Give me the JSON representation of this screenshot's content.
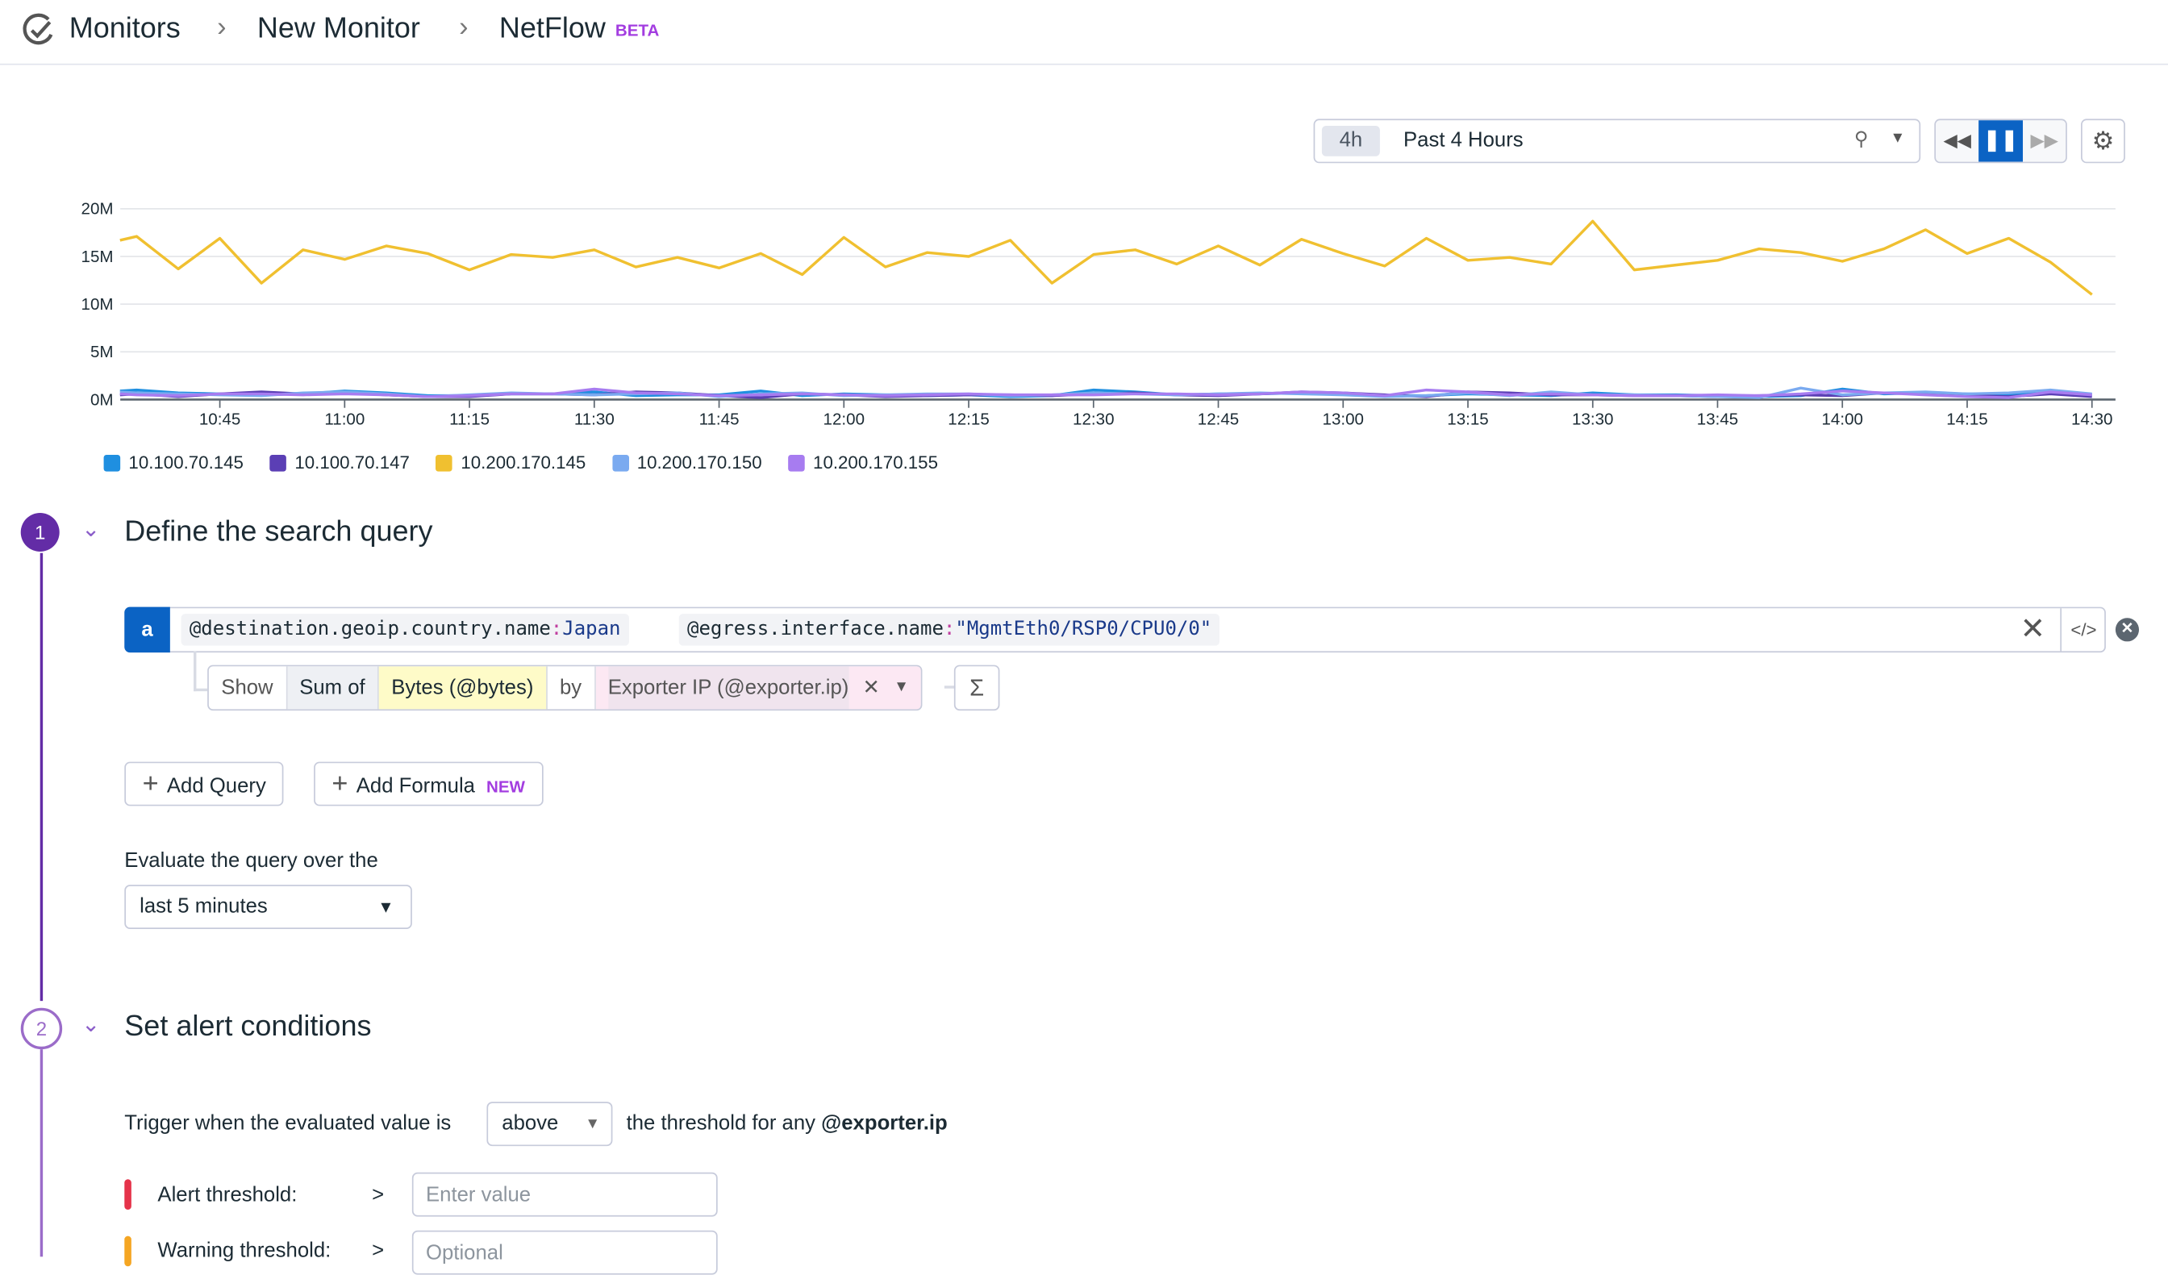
{
  "header": {
    "breadcrumbs": [
      "Monitors",
      "New Monitor",
      "NetFlow"
    ],
    "badge": "BETA"
  },
  "timepicker": {
    "short": "4h",
    "label": "Past 4 Hours"
  },
  "colors": {
    "accent": "#632ca6",
    "primary": "#0b63c4"
  },
  "chart_data": {
    "type": "line",
    "y_ticks": [
      "0M",
      "5M",
      "10M",
      "15M",
      "20M"
    ],
    "ylim": [
      0,
      20
    ],
    "y_unit": "M bytes",
    "x_ticks": [
      "10:45",
      "11:00",
      "11:15",
      "11:30",
      "11:45",
      "12:00",
      "12:15",
      "12:30",
      "12:45",
      "13:00",
      "13:15",
      "13:30",
      "13:45",
      "14:00",
      "14:15",
      "14:30"
    ],
    "x_start_minutes": 633,
    "x_step_minutes": 5,
    "x_first_offset": 2,
    "grid": true,
    "legend_position": "bottom-left",
    "series": [
      {
        "name": "10.100.70.145",
        "color": "#1f8fe0",
        "values": [
          0.9,
          1.0,
          0.7,
          0.6,
          0.5,
          0.6,
          0.9,
          0.7,
          0.4,
          0.4,
          0.6,
          0.6,
          0.8,
          0.4,
          0.5,
          0.5,
          0.9,
          0.4,
          0.6,
          0.5,
          0.4,
          0.5,
          0.3,
          0.4,
          1.0,
          0.8,
          0.5,
          0.6,
          0.6,
          0.7,
          0.6,
          0.4,
          0.4,
          0.6,
          0.5,
          0.4,
          0.7,
          0.5,
          0.5,
          0.4,
          0.3,
          0.4,
          1.1,
          0.6,
          0.7,
          0.6,
          0.5,
          0.8,
          0.5
        ]
      },
      {
        "name": "10.100.70.147",
        "color": "#5b3fb5",
        "values": [
          0.5,
          0.6,
          0.3,
          0.6,
          0.8,
          0.6,
          0.7,
          0.5,
          0.3,
          0.3,
          0.6,
          0.6,
          0.5,
          0.8,
          0.7,
          0.4,
          0.2,
          0.6,
          0.5,
          0.3,
          0.4,
          0.5,
          0.5,
          0.4,
          0.6,
          0.7,
          0.5,
          0.4,
          0.6,
          0.8,
          0.7,
          0.5,
          0.3,
          0.8,
          0.7,
          0.5,
          0.5,
          0.4,
          0.4,
          0.3,
          0.4,
          0.5,
          0.4,
          0.7,
          0.6,
          0.4,
          0.3,
          0.6,
          0.3
        ]
      },
      {
        "name": "10.200.170.145",
        "color": "#f0c030",
        "values": [
          16.7,
          17.1,
          13.7,
          16.9,
          12.2,
          15.7,
          14.7,
          16.1,
          15.3,
          13.6,
          15.2,
          14.9,
          15.7,
          13.9,
          14.9,
          13.8,
          15.3,
          13.1,
          17.0,
          13.9,
          15.4,
          15.0,
          16.7,
          12.2,
          15.2,
          15.7,
          14.2,
          16.1,
          14.1,
          16.8,
          15.3,
          14.0,
          16.9,
          14.6,
          14.9,
          14.2,
          18.7,
          13.6,
          14.1,
          14.6,
          15.8,
          15.4,
          14.5,
          15.8,
          17.8,
          15.3,
          16.9,
          14.4,
          11.0
        ]
      },
      {
        "name": "10.200.170.150",
        "color": "#7aaaf0",
        "values": [
          0.8,
          0.7,
          0.6,
          0.5,
          0.4,
          0.7,
          0.8,
          0.6,
          0.3,
          0.5,
          0.7,
          0.6,
          0.5,
          0.6,
          0.7,
          0.3,
          0.6,
          0.7,
          0.4,
          0.5,
          0.6,
          0.6,
          0.4,
          0.5,
          0.7,
          0.6,
          0.5,
          0.6,
          0.7,
          0.6,
          0.5,
          0.3,
          0.4,
          0.7,
          0.4,
          0.8,
          0.5,
          0.5,
          0.4,
          0.3,
          0.2,
          1.2,
          0.5,
          0.7,
          0.8,
          0.6,
          0.7,
          1.0,
          0.6
        ]
      },
      {
        "name": "10.200.170.155",
        "color": "#a77cf0",
        "values": [
          0.6,
          0.5,
          0.4,
          0.6,
          0.6,
          0.5,
          0.6,
          0.5,
          0.3,
          0.4,
          0.6,
          0.6,
          1.1,
          0.7,
          0.6,
          0.4,
          0.5,
          0.6,
          0.5,
          0.4,
          0.5,
          0.6,
          0.5,
          0.5,
          0.5,
          0.6,
          0.6,
          0.5,
          0.6,
          0.8,
          0.7,
          0.4,
          1.0,
          0.8,
          0.5,
          0.6,
          0.5,
          0.4,
          0.4,
          0.5,
          0.4,
          0.6,
          0.9,
          0.7,
          0.5,
          0.3,
          0.2,
          0.8,
          0.5
        ]
      }
    ]
  },
  "section1": {
    "step": "1",
    "title": "Define the search query",
    "query": {
      "letter": "a",
      "chip1_key": "@destination.geoip.country.name",
      "chip1_sep": ":",
      "chip1_val": "Japan",
      "chip2_key": "@egress.interface.name",
      "chip2_sep": ":",
      "chip2_val": "\"MgmtEth0/RSP0/CPU0/0\""
    },
    "sub": {
      "show": "Show",
      "agg": "Sum of",
      "measure": "Bytes (@bytes)",
      "by": "by",
      "group": "Exporter IP (@exporter.ip)"
    },
    "add_query": "Add Query",
    "add_formula": "Add Formula",
    "new_badge": "NEW",
    "eval_label": "Evaluate the query over the",
    "eval_value": "last 5 minutes"
  },
  "section2": {
    "step": "2",
    "title": "Set alert conditions",
    "trigger_pre": "Trigger when the evaluated value is",
    "trigger_value": "above",
    "trigger_post": "the threshold for any",
    "trigger_field": "@exporter.ip",
    "alert_label": "Alert threshold:",
    "alert_op": ">",
    "alert_placeholder": "Enter value",
    "warning_label": "Warning threshold:",
    "warning_op": ">",
    "warning_placeholder": "Optional"
  }
}
